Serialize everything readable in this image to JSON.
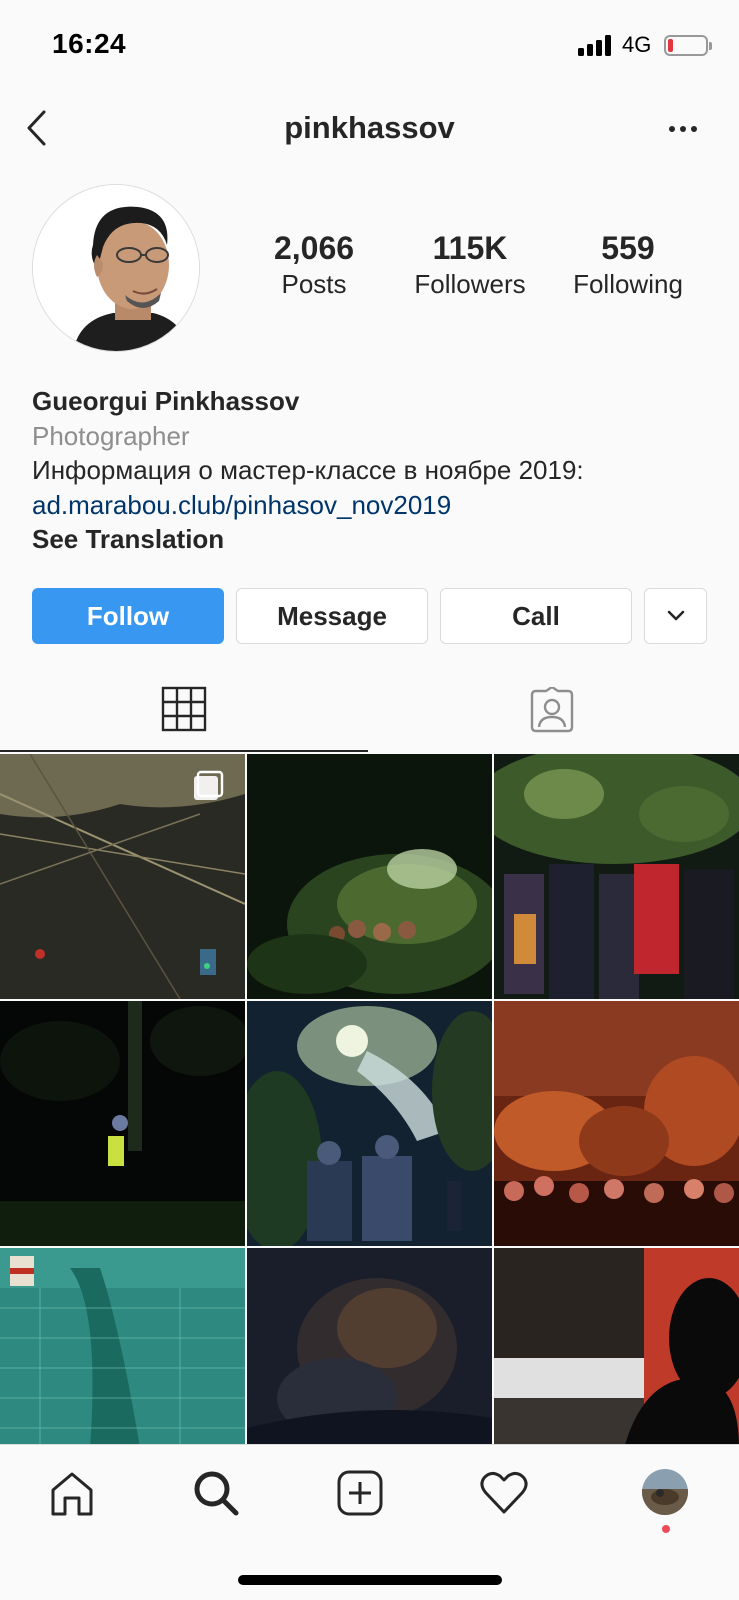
{
  "status_bar": {
    "time": "16:24",
    "network": "4G",
    "icons": [
      "signal-icon",
      "battery-icon"
    ]
  },
  "header": {
    "username": "pinkhassov",
    "icons": [
      "back-icon",
      "more-icon"
    ]
  },
  "stats": [
    {
      "value": "2,066",
      "label": "Posts"
    },
    {
      "value": "115K",
      "label": "Followers"
    },
    {
      "value": "559",
      "label": "Following"
    }
  ],
  "bio": {
    "name": "Gueorgui Pinkhassov",
    "category": "Photographer",
    "text": "Информация о мастер-классе в ноябре 2019:",
    "link": "ad.marabou.club/pinhasov_nov2019",
    "translate": "See Translation"
  },
  "buttons": {
    "follow": "Follow",
    "message": "Message",
    "call": "Call"
  },
  "tabs": {
    "icons": [
      "grid-icon",
      "tagged-icon"
    ],
    "active": "grid"
  },
  "posts": [
    {
      "name": "post-wires-night",
      "colors": [
        "#3b3a30",
        "#7a7250",
        "#1a1a18"
      ]
    },
    {
      "name": "post-dark-foliage",
      "colors": [
        "#0d1a0e",
        "#3d5a2a",
        "#8a7a40"
      ]
    },
    {
      "name": "post-crowd-tree",
      "colors": [
        "#1b2a1a",
        "#4c6b3a",
        "#c0262e"
      ]
    },
    {
      "name": "post-dark-forest-figure",
      "colors": [
        "#050806",
        "#1d2a1c",
        "#c8e040"
      ]
    },
    {
      "name": "post-police-light",
      "colors": [
        "#1a2a35",
        "#8fa6b0",
        "#d8e8e8"
      ]
    },
    {
      "name": "post-red-sky-crowd",
      "colors": [
        "#7a2a18",
        "#c04a22",
        "#2a0d08"
      ]
    },
    {
      "name": "post-green-net",
      "colors": [
        "#2e8a80",
        "#5ab0a0",
        "#1a5a50"
      ]
    },
    {
      "name": "post-dark-textile",
      "colors": [
        "#1a1e2a",
        "#4a3a30",
        "#2a2e3a"
      ]
    },
    {
      "name": "post-window-silhouette",
      "colors": [
        "#c03a2a",
        "#e8e8e8",
        "#0a0a0a"
      ]
    }
  ],
  "bottom_nav": {
    "icons": [
      "home-icon",
      "search-icon",
      "add-post-icon",
      "activity-heart-icon",
      "profile-avatar"
    ]
  }
}
